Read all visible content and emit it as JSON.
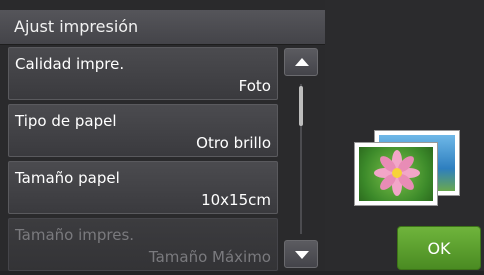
{
  "title": "Ajust impresión",
  "menu": {
    "items": [
      {
        "label": "Calidad impre.",
        "value": "Foto"
      },
      {
        "label": "Tipo de papel",
        "value": "Otro brillo"
      },
      {
        "label": "Tamaño papel",
        "value": "10x15cm"
      },
      {
        "label": "Tamaño impres.",
        "value": "Tamaño Máximo"
      }
    ]
  },
  "buttons": {
    "ok_label": "OK",
    "scroll_up_icon": "triangle-up",
    "scroll_down_icon": "triangle-down"
  },
  "scroll": {
    "position_fraction": 0.0,
    "visible_fraction": 0.27
  },
  "colors": {
    "ok_button": "#5a9e2f",
    "background": "#2a2a2c",
    "disabled_text": "#7a7a7e"
  },
  "illustration": "photo-icon-flower"
}
